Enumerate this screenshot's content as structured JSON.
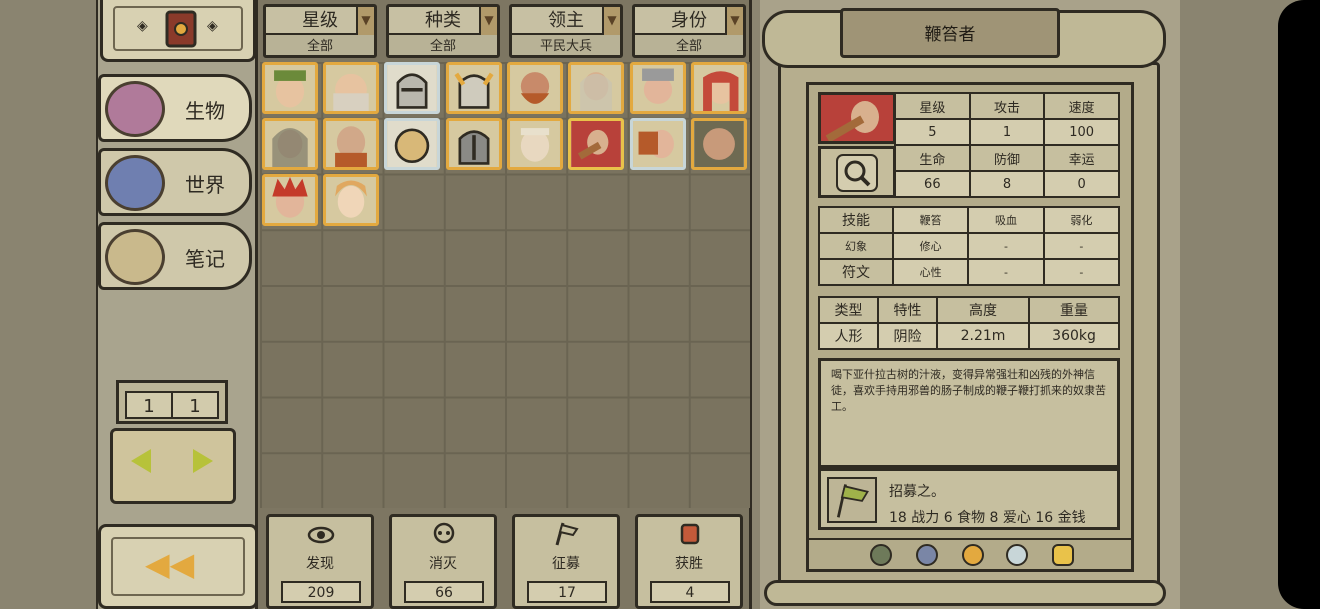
{
  "left": {
    "categories": [
      {
        "label": "生物",
        "icon": "creature-icon"
      },
      {
        "label": "世界",
        "icon": "globe-icon"
      },
      {
        "label": "笔记",
        "icon": "notes-icon"
      }
    ],
    "page": {
      "current": "1",
      "total": "1"
    }
  },
  "filters": [
    {
      "title": "星级",
      "value": "全部"
    },
    {
      "title": "种类",
      "value": "全部"
    },
    {
      "title": "领主",
      "value": "平民大兵"
    },
    {
      "title": "身份",
      "value": "全部"
    }
  ],
  "stats_cards": [
    {
      "label": "发现",
      "value": "209",
      "icon": "eye-icon"
    },
    {
      "label": "消灭",
      "value": "66",
      "icon": "skull-icon"
    },
    {
      "label": "征募",
      "value": "17",
      "icon": "flag-icon"
    },
    {
      "label": "获胜",
      "value": "4",
      "icon": "fist-icon"
    }
  ],
  "creature": {
    "name": "鞭笞者",
    "attrs": {
      "star_label": "星级",
      "atk_label": "攻击",
      "spd_label": "速度",
      "star": "5",
      "atk": "1",
      "spd": "100",
      "hp_label": "生命",
      "def_label": "防御",
      "luck_label": "幸运",
      "hp": "66",
      "def": "8",
      "luck": "0"
    },
    "skills": {
      "skill_label": "技能",
      "s1": "鞭笞",
      "s2": "吸血",
      "s3": "弱化",
      "illusion_label": "幻象",
      "i1": "修心",
      "i2": "-",
      "i3": "-",
      "rune_label": "符文",
      "r1": "心性",
      "r2": "-",
      "r3": "-"
    },
    "traits": {
      "type_label": "类型",
      "trait_label": "特性",
      "height_label": "高度",
      "weight_label": "重量",
      "type": "人形",
      "trait": "阴险",
      "height": "2.21m",
      "weight": "360kg"
    },
    "description": "喝下亚什拉古树的汁液，变得异常强壮和凶残的外神信徒，喜欢手持用邪兽的肠子制成的鞭子鞭打抓来的奴隶苦工。",
    "recruit_title": "招募之。",
    "recruit_cost": "18 战力 6 食物 8 爱心 16 金钱"
  },
  "colors": {
    "orange_frame": "#e3a93f",
    "silver_frame": "#c8d6d8",
    "gold_frame": "#e9c24a"
  }
}
